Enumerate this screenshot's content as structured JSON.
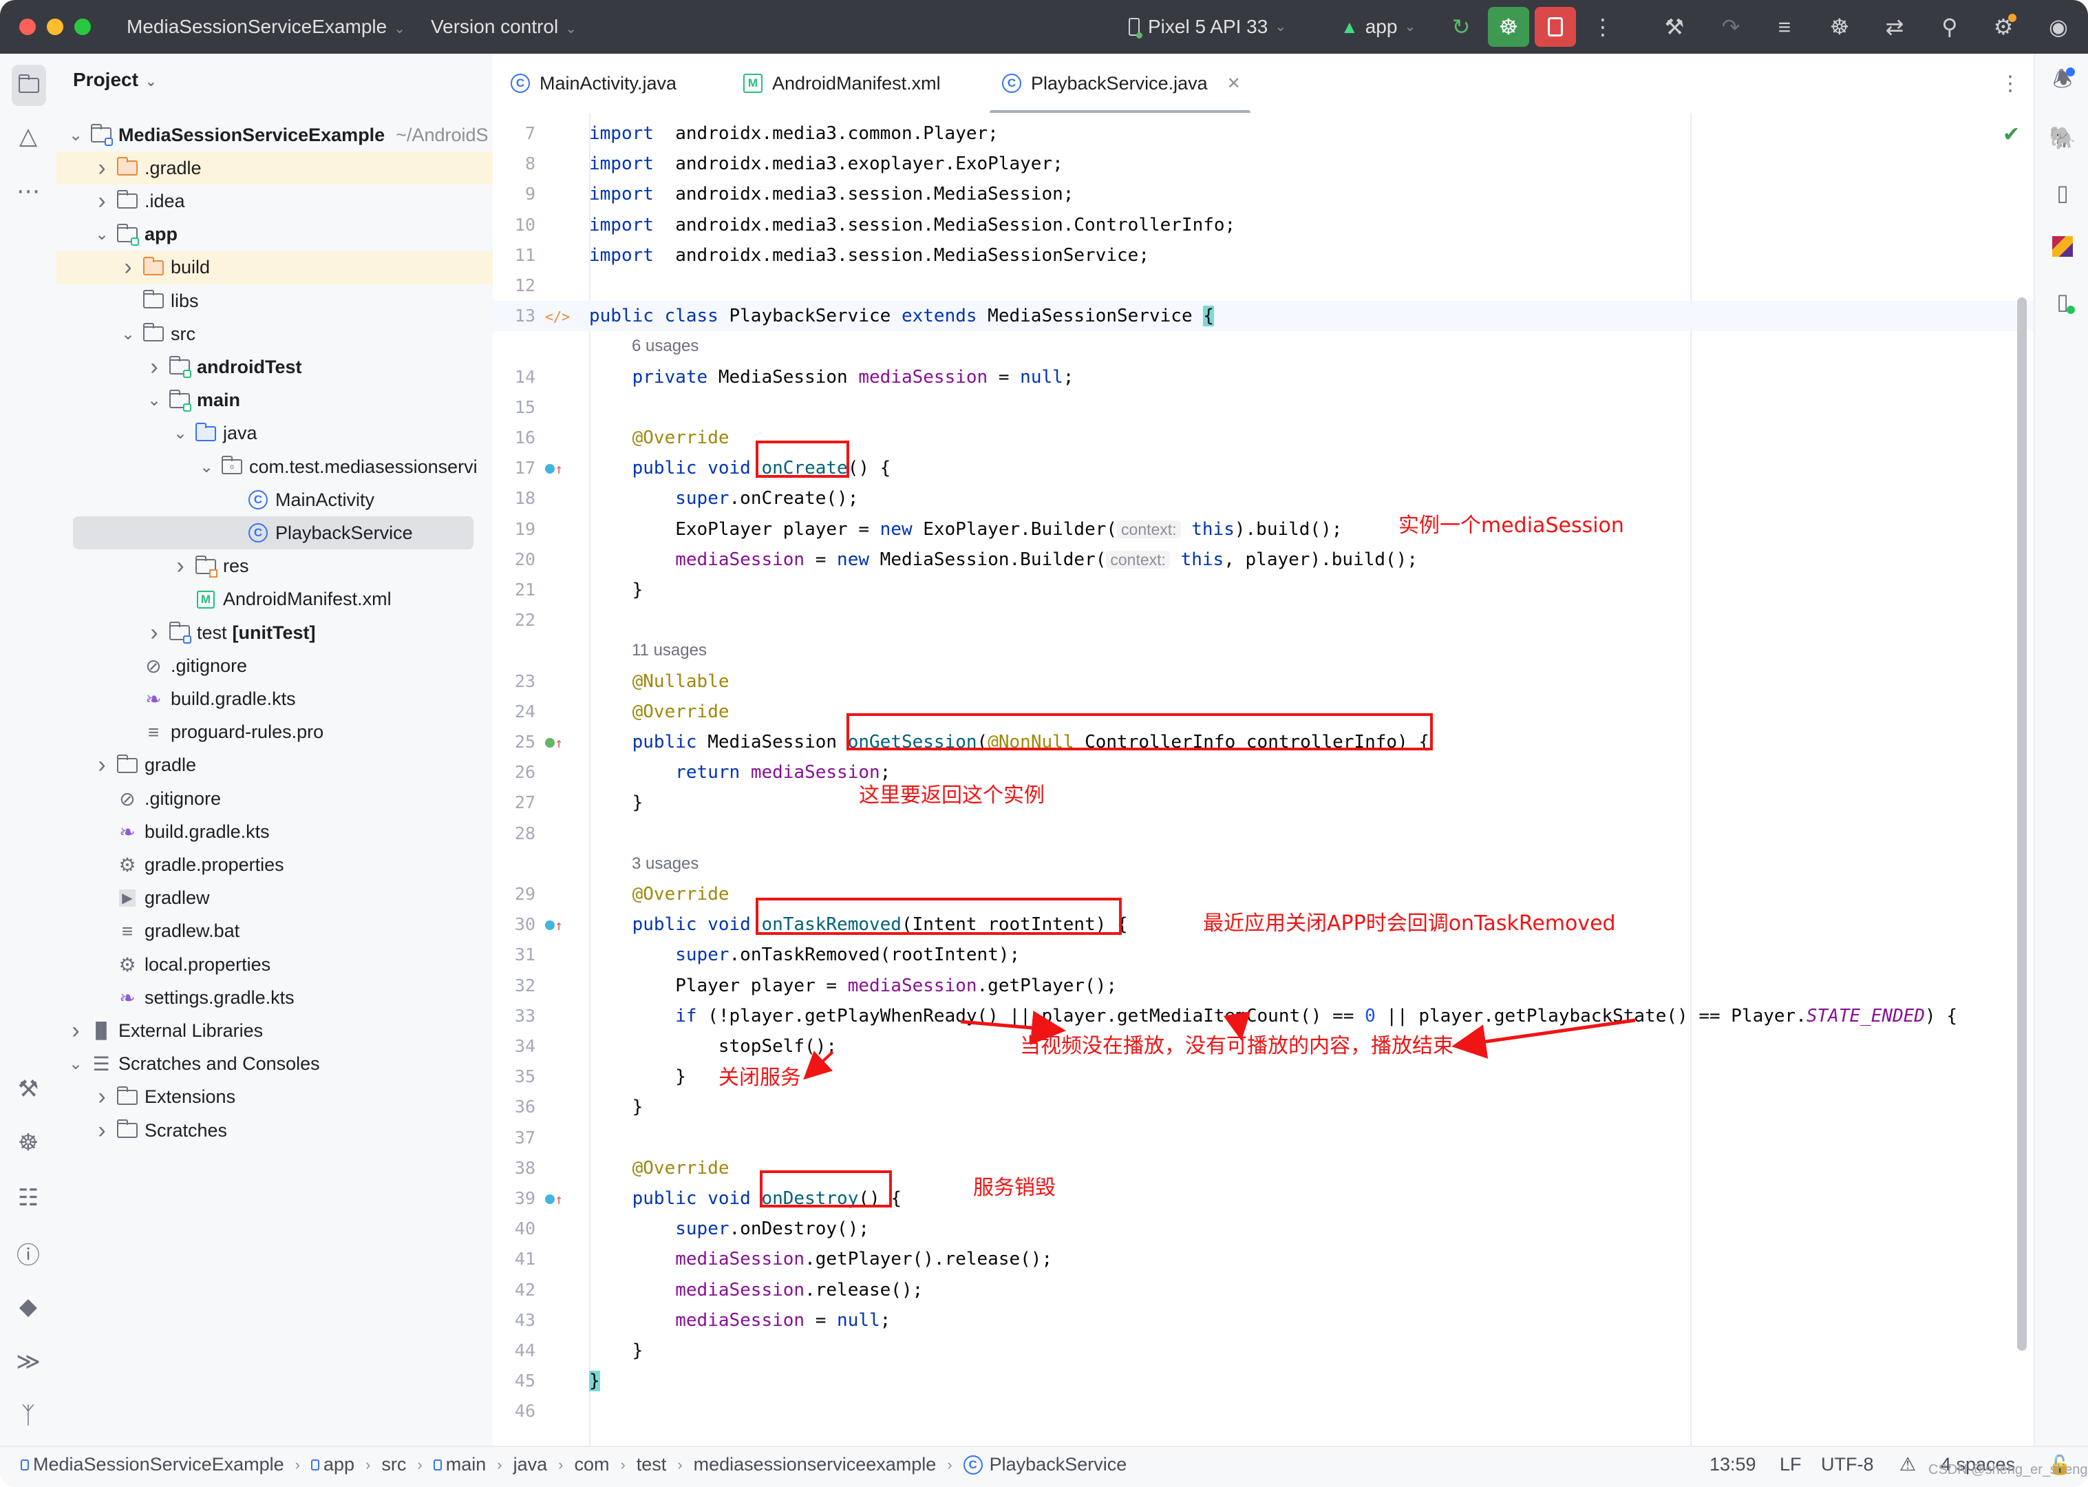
{
  "titlebar": {
    "project_name": "MediaSessionServiceExample",
    "vcs_label": "Version control",
    "device": "Pixel 5 API 33",
    "run_config": "app",
    "icons": [
      "rerun-icon",
      "debug-icon",
      "stop-icon",
      "more-icon",
      "build-icon",
      "translate-icon",
      "code-format-icon",
      "attach-debugger-icon",
      "gradle-sync-icon",
      "search-icon",
      "settings-icon",
      "account-icon"
    ]
  },
  "left_strip": {
    "top_icons": [
      "project-icon",
      "resource-manager-icon",
      "more-tools-icon"
    ],
    "bottom_icons": [
      "build-icon",
      "debug-icon",
      "logcat-icon",
      "problems-icon",
      "app-quality-icon",
      "terminal-icon",
      "git-icon"
    ]
  },
  "project_panel": {
    "title": "Project",
    "tree": [
      {
        "label": "MediaSessionServiceExample",
        "suffix": "~/AndroidS",
        "depth": 0,
        "expander": "open",
        "icon": "module-folder",
        "bold": true
      },
      {
        "label": ".gradle",
        "depth": 1,
        "expander": "closed",
        "icon": "folder-excluded",
        "highlight": true
      },
      {
        "label": ".idea",
        "depth": 1,
        "expander": "closed",
        "icon": "folder"
      },
      {
        "label": "app",
        "depth": 1,
        "expander": "open",
        "icon": "module-folder-green",
        "bold": true
      },
      {
        "label": "build",
        "depth": 2,
        "expander": "closed",
        "icon": "folder-excluded",
        "highlight": true
      },
      {
        "label": "libs",
        "depth": 2,
        "expander": "none",
        "icon": "folder"
      },
      {
        "label": "src",
        "depth": 2,
        "expander": "open",
        "icon": "folder"
      },
      {
        "label": "androidTest",
        "depth": 3,
        "expander": "closed",
        "icon": "module-folder-green",
        "bold": true
      },
      {
        "label": "main",
        "depth": 3,
        "expander": "open",
        "icon": "module-folder-green",
        "bold": true
      },
      {
        "label": "java",
        "depth": 4,
        "expander": "open",
        "icon": "folder-source"
      },
      {
        "label": "com.test.mediasessionservi",
        "depth": 5,
        "expander": "open",
        "icon": "package"
      },
      {
        "label": "MainActivity",
        "depth": 6,
        "expander": "none",
        "icon": "class"
      },
      {
        "label": "PlaybackService",
        "depth": 6,
        "expander": "none",
        "icon": "class",
        "selected": true
      },
      {
        "label": "res",
        "depth": 4,
        "expander": "closed",
        "icon": "folder-res"
      },
      {
        "label": "AndroidManifest.xml",
        "depth": 4,
        "expander": "none",
        "icon": "manifest"
      },
      {
        "label": "test",
        "label_bold": "[unitTest]",
        "depth": 3,
        "expander": "closed",
        "icon": "module-folder-blue"
      },
      {
        "label": ".gitignore",
        "depth": 2,
        "expander": "none",
        "icon": "ignore"
      },
      {
        "label": "build.gradle.kts",
        "depth": 2,
        "expander": "none",
        "icon": "gradle-kts"
      },
      {
        "label": "proguard-rules.pro",
        "depth": 2,
        "expander": "none",
        "icon": "text"
      },
      {
        "label": "gradle",
        "depth": 1,
        "expander": "closed",
        "icon": "folder"
      },
      {
        "label": ".gitignore",
        "depth": 1,
        "expander": "none",
        "icon": "ignore"
      },
      {
        "label": "build.gradle.kts",
        "depth": 1,
        "expander": "none",
        "icon": "gradle-kts"
      },
      {
        "label": "gradle.properties",
        "depth": 1,
        "expander": "none",
        "icon": "properties"
      },
      {
        "label": "gradlew",
        "depth": 1,
        "expander": "none",
        "icon": "shell"
      },
      {
        "label": "gradlew.bat",
        "depth": 1,
        "expander": "none",
        "icon": "text"
      },
      {
        "label": "local.properties",
        "depth": 1,
        "expander": "none",
        "icon": "properties"
      },
      {
        "label": "settings.gradle.kts",
        "depth": 1,
        "expander": "none",
        "icon": "gradle-kts"
      },
      {
        "label": "External Libraries",
        "depth": 0,
        "expander": "closed",
        "icon": "libraries"
      },
      {
        "label": "Scratches and Consoles",
        "depth": 0,
        "expander": "open",
        "icon": "scratches"
      },
      {
        "label": "Extensions",
        "depth": 1,
        "expander": "closed",
        "icon": "folder"
      },
      {
        "label": "Scratches",
        "depth": 1,
        "expander": "closed",
        "icon": "folder"
      }
    ]
  },
  "tabs": [
    {
      "label": "MainActivity.java",
      "icon": "class",
      "active": false
    },
    {
      "label": "AndroidManifest.xml",
      "icon": "manifest",
      "active": false
    },
    {
      "label": "PlaybackService.java",
      "icon": "class",
      "active": true,
      "closable": true
    }
  ],
  "editor": {
    "inspection_status": "no-problems-check",
    "lines": [
      {
        "n": "7",
        "tokens": [
          [
            "kw",
            "import"
          ],
          [
            "",
            "  androidx.media3.common.Player;"
          ]
        ]
      },
      {
        "n": "8",
        "tokens": [
          [
            "kw",
            "import"
          ],
          [
            "",
            "  androidx.media3.exoplayer.ExoPlayer;"
          ]
        ]
      },
      {
        "n": "9",
        "tokens": [
          [
            "kw",
            "import"
          ],
          [
            "",
            "  androidx.media3.session.MediaSession;"
          ]
        ]
      },
      {
        "n": "10",
        "tokens": [
          [
            "kw",
            "import"
          ],
          [
            "",
            "  androidx.media3.session.MediaSession.ControllerInfo;"
          ]
        ]
      },
      {
        "n": "11",
        "tokens": [
          [
            "kw",
            "import"
          ],
          [
            "",
            "  androidx.media3.session.MediaSessionService;"
          ]
        ]
      },
      {
        "n": "12",
        "tokens": []
      },
      {
        "n": "13",
        "marker": "implemented",
        "current": true,
        "tokens": [
          [
            "kw",
            "public class"
          ],
          [
            "",
            " PlaybackService "
          ],
          [
            "kw",
            "extends"
          ],
          [
            "",
            " MediaSessionService "
          ],
          [
            "brace",
            "{"
          ]
        ]
      },
      {
        "usage": "6 usages"
      },
      {
        "n": "14",
        "tokens": [
          [
            "",
            "    "
          ],
          [
            "kw",
            "private"
          ],
          [
            "",
            " MediaSession "
          ],
          [
            "fld",
            "mediaSession"
          ],
          [
            "",
            " = "
          ],
          [
            "kw",
            "null"
          ],
          [
            "",
            ";"
          ]
        ]
      },
      {
        "n": "15",
        "tokens": []
      },
      {
        "n": "16",
        "tokens": [
          [
            "",
            "    "
          ],
          [
            "an",
            "@Override"
          ]
        ]
      },
      {
        "n": "17",
        "marker": "override",
        "tokens": [
          [
            "",
            "    "
          ],
          [
            "kw",
            "public void"
          ],
          [
            "",
            " "
          ],
          [
            "fn",
            "onCreate"
          ],
          [
            "",
            "() {"
          ]
        ]
      },
      {
        "n": "18",
        "tokens": [
          [
            "",
            "        "
          ],
          [
            "kw",
            "super"
          ],
          [
            "",
            ".onCreate();"
          ]
        ]
      },
      {
        "n": "19",
        "tokens": [
          [
            "",
            "        ExoPlayer player = "
          ],
          [
            "kw",
            "new"
          ],
          [
            "",
            " ExoPlayer.Builder("
          ],
          [
            "hint",
            "context:"
          ],
          [
            "",
            " "
          ],
          [
            "kw",
            "this"
          ],
          [
            "",
            ").build();"
          ]
        ]
      },
      {
        "n": "20",
        "tokens": [
          [
            "",
            "        "
          ],
          [
            "fld",
            "mediaSession"
          ],
          [
            "",
            " = "
          ],
          [
            "kw",
            "new"
          ],
          [
            "",
            " MediaSession.Builder("
          ],
          [
            "hint",
            "context:"
          ],
          [
            "",
            " "
          ],
          [
            "kw",
            "this"
          ],
          [
            "",
            ", player).build();"
          ]
        ]
      },
      {
        "n": "21",
        "tokens": [
          [
            "",
            "    }"
          ]
        ]
      },
      {
        "n": "22",
        "tokens": []
      },
      {
        "usage": "11 usages"
      },
      {
        "n": "23",
        "tokens": [
          [
            "",
            "    "
          ],
          [
            "an",
            "@Nullable"
          ]
        ]
      },
      {
        "n": "24",
        "tokens": [
          [
            "",
            "    "
          ],
          [
            "an",
            "@Override"
          ]
        ]
      },
      {
        "n": "25",
        "marker": "implements",
        "tokens": [
          [
            "",
            "    "
          ],
          [
            "kw",
            "public"
          ],
          [
            "",
            " MediaSession "
          ],
          [
            "fn",
            "onGetSession"
          ],
          [
            "",
            "("
          ],
          [
            "an",
            "@NonNull"
          ],
          [
            "",
            " ControllerInfo controllerInfo) {"
          ]
        ]
      },
      {
        "n": "26",
        "tokens": [
          [
            "",
            "        "
          ],
          [
            "kw",
            "return"
          ],
          [
            "",
            " "
          ],
          [
            "fld",
            "mediaSession"
          ],
          [
            "",
            ";"
          ]
        ]
      },
      {
        "n": "27",
        "tokens": [
          [
            "",
            "    }"
          ]
        ]
      },
      {
        "n": "28",
        "tokens": []
      },
      {
        "usage": "3 usages"
      },
      {
        "n": "29",
        "tokens": [
          [
            "",
            "    "
          ],
          [
            "an",
            "@Override"
          ]
        ]
      },
      {
        "n": "30",
        "marker": "override",
        "tokens": [
          [
            "",
            "    "
          ],
          [
            "kw",
            "public void"
          ],
          [
            "",
            " "
          ],
          [
            "fn",
            "onTaskRemoved"
          ],
          [
            "",
            "(Intent rootIntent) {"
          ]
        ]
      },
      {
        "n": "31",
        "tokens": [
          [
            "",
            "        "
          ],
          [
            "kw",
            "super"
          ],
          [
            "",
            ".onTaskRemoved(rootIntent);"
          ]
        ]
      },
      {
        "n": "32",
        "tokens": [
          [
            "",
            "        Player player = "
          ],
          [
            "fld",
            "mediaSession"
          ],
          [
            "",
            ".getPlayer();"
          ]
        ]
      },
      {
        "n": "33",
        "tokens": [
          [
            "",
            "        "
          ],
          [
            "kw",
            "if"
          ],
          [
            "",
            " (!player.getPlayWhenReady() || player.getMediaItemCount() == "
          ],
          [
            "num",
            "0"
          ],
          [
            "",
            " || player.getPlaybackState() == Player."
          ],
          [
            "cst",
            "STATE_ENDED"
          ],
          [
            "",
            ") {"
          ]
        ]
      },
      {
        "n": "34",
        "tokens": [
          [
            "",
            "            stopSelf();"
          ]
        ]
      },
      {
        "n": "35",
        "tokens": [
          [
            "",
            "        }"
          ]
        ]
      },
      {
        "n": "36",
        "tokens": [
          [
            "",
            "    }"
          ]
        ]
      },
      {
        "n": "37",
        "tokens": []
      },
      {
        "n": "38",
        "tokens": [
          [
            "",
            "    "
          ],
          [
            "an",
            "@Override"
          ]
        ]
      },
      {
        "n": "39",
        "marker": "override",
        "tokens": [
          [
            "",
            "    "
          ],
          [
            "kw",
            "public void"
          ],
          [
            "",
            " "
          ],
          [
            "fn",
            "onDestroy"
          ],
          [
            "",
            "() {"
          ]
        ]
      },
      {
        "n": "40",
        "tokens": [
          [
            "",
            "        "
          ],
          [
            "kw",
            "super"
          ],
          [
            "",
            ".onDestroy();"
          ]
        ]
      },
      {
        "n": "41",
        "tokens": [
          [
            "",
            "        "
          ],
          [
            "fld",
            "mediaSession"
          ],
          [
            "",
            ".getPlayer().release();"
          ]
        ]
      },
      {
        "n": "42",
        "tokens": [
          [
            "",
            "        "
          ],
          [
            "fld",
            "mediaSession"
          ],
          [
            "",
            ".release();"
          ]
        ]
      },
      {
        "n": "43",
        "tokens": [
          [
            "",
            "        "
          ],
          [
            "fld",
            "mediaSession"
          ],
          [
            "",
            " = "
          ],
          [
            "kw",
            "null"
          ],
          [
            "",
            ";"
          ]
        ]
      },
      {
        "n": "44",
        "tokens": [
          [
            "",
            "    }"
          ]
        ]
      },
      {
        "n": "45",
        "tokens": [
          [
            "brace",
            "}"
          ]
        ]
      },
      {
        "n": "46",
        "tokens": []
      }
    ],
    "annotations": {
      "oncreate_note": "实例一个mediaSession",
      "ongetsession_note": "这里要返回这个实例",
      "ontaskremoved_note": "最近应用关闭APP时会回调onTaskRemoved",
      "condition_note": "当视频没在播放，没有可播放的内容，播放结束",
      "stopself_note": "关闭服务",
      "ondestroy_note": "服务销毁",
      "color": "#f01414"
    }
  },
  "right_strip": {
    "icons": [
      "notifications-icon",
      "gradle-icon",
      "device-manager-icon",
      "plantuml-icon",
      "running-devices-icon"
    ]
  },
  "statusbar": {
    "breadcrumbs": [
      {
        "label": "MediaSessionServiceExample",
        "icon": "module"
      },
      {
        "label": "app",
        "icon": "module"
      },
      {
        "label": "src"
      },
      {
        "label": "main",
        "icon": "module"
      },
      {
        "label": "java"
      },
      {
        "label": "com"
      },
      {
        "label": "test"
      },
      {
        "label": "mediasessionserviceexample"
      },
      {
        "label": "PlaybackService",
        "icon": "class"
      }
    ],
    "caret_position": "13:59",
    "line_separator": "LF",
    "encoding": "UTF-8",
    "indent": "4 spaces"
  },
  "watermark": "CSDN @sheng_er_sheng"
}
